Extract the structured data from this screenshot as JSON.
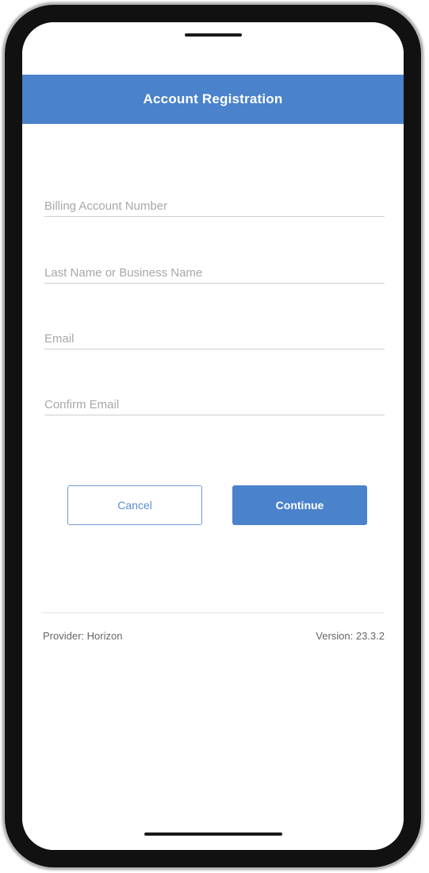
{
  "header": {
    "title": "Account Registration"
  },
  "form": {
    "billing_account_number": {
      "placeholder": "Billing Account Number",
      "value": ""
    },
    "last_name": {
      "placeholder": "Last Name or Business Name",
      "value": ""
    },
    "email": {
      "placeholder": "Email",
      "value": ""
    },
    "confirm_email": {
      "placeholder": "Confirm Email",
      "value": ""
    }
  },
  "buttons": {
    "cancel_label": "Cancel",
    "continue_label": "Continue"
  },
  "footer": {
    "provider": "Provider: Horizon",
    "version": "Version: 23.3.2"
  },
  "colors": {
    "accent": "#4a82cb",
    "frame": "#111111"
  }
}
